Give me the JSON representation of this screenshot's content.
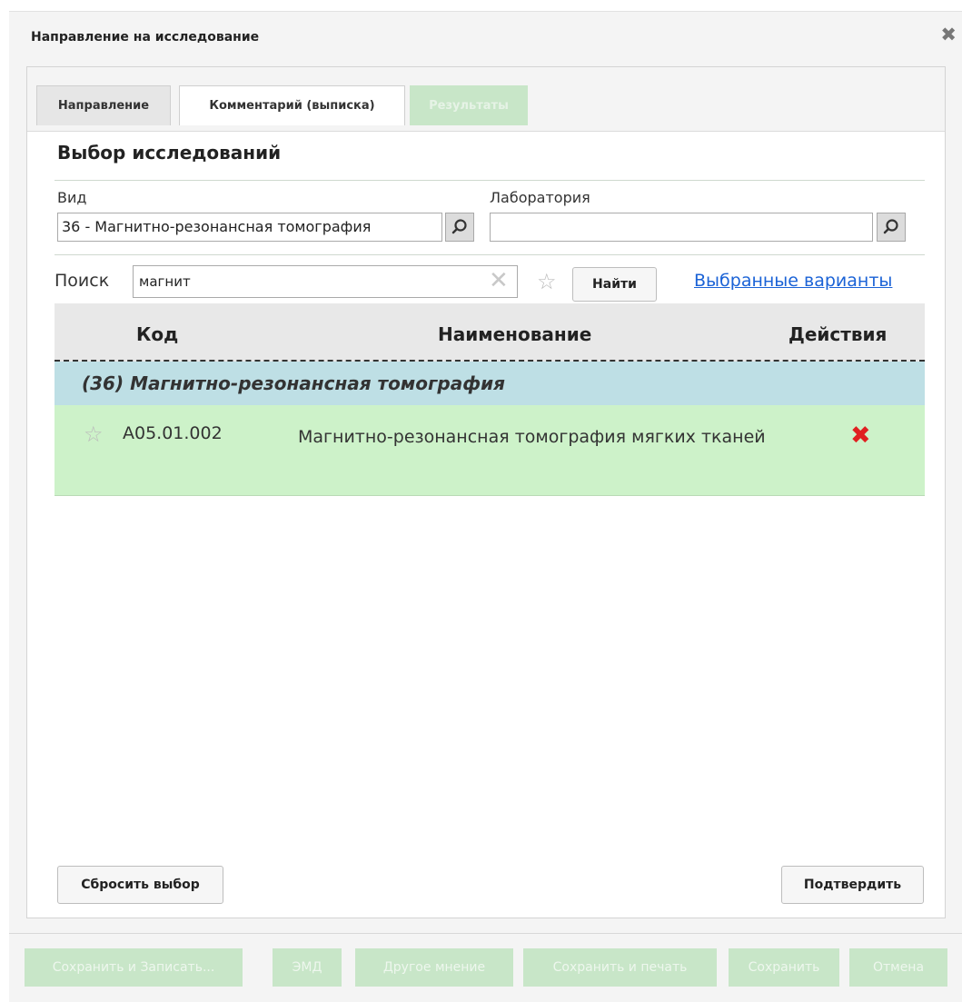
{
  "dialog": {
    "title": "Направление на исследование",
    "close_icon": "close-icon"
  },
  "tabs": [
    {
      "label": "Направление",
      "state": "active"
    },
    {
      "label": "Комментарий (выписка)",
      "state": "inactive"
    },
    {
      "label": "Результаты",
      "state": "disabled"
    }
  ],
  "section": {
    "title": "Выбор исследований"
  },
  "filters": {
    "vid_label": "Вид",
    "vid_value": "36 - Магнитно-резонансная томография",
    "lab_label": "Лаборатория",
    "lab_value": ""
  },
  "search": {
    "label": "Поиск",
    "value": "магнит",
    "find_label": "Найти",
    "favorites_link": "Выбранные варианты"
  },
  "table": {
    "columns": [
      "Код",
      "Наименование",
      "Действия"
    ],
    "group": "(36) Магнитно-резонансная томография",
    "rows": [
      {
        "code": "A05.01.002",
        "name": "Магнитно-резонансная томография мягких тканей",
        "action_icon": "remove-icon"
      }
    ]
  },
  "panel_buttons": {
    "reset": "Сбросить выбор",
    "confirm": "Подтвердить"
  },
  "footer_buttons": [
    "Сохранить и Записать...",
    "ЭМД",
    "Другое мнение",
    "Сохранить и печать",
    "Сохранить",
    "Отмена"
  ],
  "colors": {
    "group_row": "#bedfe5",
    "selected_row": "#cdf2c9",
    "link": "#1a62d6",
    "remove_icon": "#e02020",
    "disabled_button": "#c8e6c8"
  }
}
